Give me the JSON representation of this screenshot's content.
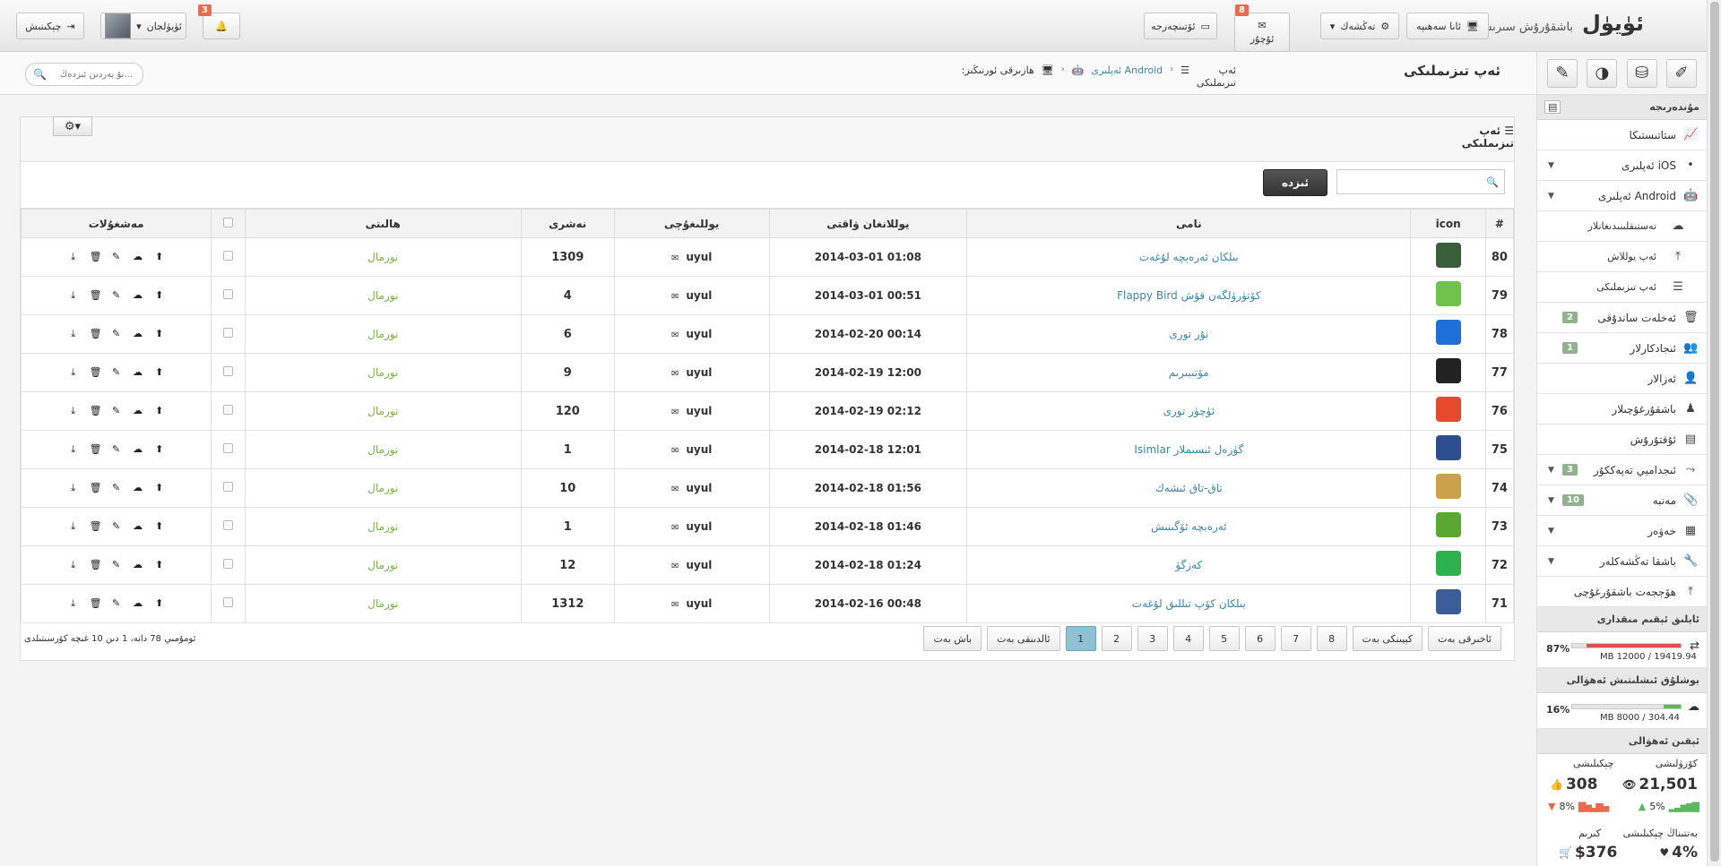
{
  "topbar": {
    "brand": "ئۈيۈل",
    "brand_sub": "باشقۇرۇش سىرىسى",
    "home_btn": "ئانا سەھىپە",
    "settings_btn": "تەڭشەك",
    "messages_btn": "ئۇچۇر",
    "messages_badge": "8",
    "credit_btn": "ئۆتىنچەرجە",
    "notify_badge": "3",
    "user_btn": "ئۈيۈلجان",
    "logout_btn": "چېكىنىش"
  },
  "crumbs": {
    "page_title": "ئەپ تىزىملىكى",
    "here": "ھازىرقى ئورنىڭىز:",
    "android": "Android ئەپلىرى",
    "current": "ئەپ تىزىملىكى",
    "search_placeholder": "بۇ يەردىن ئىزدەڭ..."
  },
  "panel": {
    "title": "ئەپ تىزىملىكى",
    "go_btn": "ئىزدە"
  },
  "table": {
    "headers": {
      "num": "#",
      "icon": "icon",
      "name": "نامى",
      "date": "يوللانغان ۋاقتى",
      "author": "يوللىغۇچى",
      "version": "نەشرى",
      "status": "ھالىتى",
      "actions": "مەشغۇلات"
    },
    "rows": [
      {
        "id": "80",
        "name": "بىلكان ئەرەبچە لۇغەت",
        "date": "2014-03-01 01:08",
        "author": "uyul",
        "version": "1309",
        "status": "نورمال",
        "icon_color": "#3a5f3a"
      },
      {
        "id": "79",
        "name": "Flappy Bird كۆتۈرۈلگەن قۇش",
        "date": "2014-03-01 00:51",
        "author": "uyul",
        "version": "4",
        "status": "نورمال",
        "icon_color": "#6fc24a"
      },
      {
        "id": "78",
        "name": "نۇر تورى",
        "date": "2014-02-20 00:14",
        "author": "uyul",
        "version": "6",
        "status": "نورمال",
        "icon_color": "#1e6fd9"
      },
      {
        "id": "77",
        "name": "مۆتىبىرىم",
        "date": "2014-02-19 12:00",
        "author": "uyul",
        "version": "9",
        "status": "نورمال",
        "icon_color": "#222222"
      },
      {
        "id": "76",
        "name": "ئۈچۈر تورى",
        "date": "2014-02-19 02:12",
        "author": "uyul",
        "version": "120",
        "status": "نورمال",
        "icon_color": "#e64a2e"
      },
      {
        "id": "75",
        "name": "Isimlar گۈزەل ئىسىملار",
        "date": "2014-02-18 12:01",
        "author": "uyul",
        "version": "1",
        "status": "نورمال",
        "icon_color": "#2d4e8f"
      },
      {
        "id": "74",
        "name": "تاق-تاق ئىشەك",
        "date": "2014-02-18 01:56",
        "author": "uyul",
        "version": "10",
        "status": "نورمال",
        "icon_color": "#c9a24a"
      },
      {
        "id": "73",
        "name": "ئەرەبچە ئۆگىنىش",
        "date": "2014-02-18 01:46",
        "author": "uyul",
        "version": "1",
        "status": "نورمال",
        "icon_color": "#5aa832"
      },
      {
        "id": "72",
        "name": "كەزگۈ",
        "date": "2014-02-18 01:24",
        "author": "uyul",
        "version": "12",
        "status": "نورمال",
        "icon_color": "#2bb24c"
      },
      {
        "id": "71",
        "name": "بىلكان كۆپ تىللىق لۇغەت",
        "date": "2014-02-16 00:48",
        "author": "uyul",
        "version": "1312",
        "status": "نورمال",
        "icon_color": "#3b5d9a"
      }
    ]
  },
  "pager": {
    "last": "ئاخىرقى بەت",
    "next": "كېيىنكى بەت",
    "pages": [
      "8",
      "7",
      "6",
      "5",
      "4",
      "3",
      "2",
      "1"
    ],
    "active": "1",
    "prev": "ئالدىنقى بەت",
    "first": "باش بەت",
    "total_text": "ئومۇمىي 78 دانە، 1 دىن 10 غىچە كۆرسىتىلدى"
  },
  "sidebar": {
    "section_main": "مۇندەرىجە",
    "items": [
      {
        "label": "ستاتىستىكا",
        "icon": "chart-icon"
      },
      {
        "label": "iOS ئەپلىرى",
        "icon": "apple-icon",
        "caret": true
      },
      {
        "label": "Android ئەپلىرى",
        "icon": "android-icon",
        "caret": true
      }
    ],
    "sub_items": [
      {
        "label": "تەستىقلىنىدىغانلار",
        "icon": "cloud-icon"
      },
      {
        "label": "ئەپ يوللاش",
        "icon": "upload-icon"
      },
      {
        "label": "ئەپ تىزىملىكى",
        "icon": "list-icon"
      }
    ],
    "items2": [
      {
        "label": "ئەخلەت ساندۇقى",
        "icon": "trash-icon",
        "count": "2"
      },
      {
        "label": "ئىجادكارلار",
        "icon": "users-icon",
        "count": "1"
      },
      {
        "label": "ئەزالار",
        "icon": "user-icon"
      },
      {
        "label": "باشقۇرغۇچىلار",
        "icon": "admin-icon"
      },
      {
        "label": "ئۇقتۇرۇش",
        "icon": "notice-icon"
      },
      {
        "label": "ئىجداميي تەپەككۇر",
        "icon": "share-icon",
        "count": "3",
        "caret": true
      },
      {
        "label": "مەنبە",
        "icon": "clip-icon",
        "count": "10",
        "caret": true
      },
      {
        "label": "خەۋەر",
        "icon": "news-icon",
        "caret": true
      },
      {
        "label": "باشقا تەڭشەكلەر",
        "icon": "wrench-icon",
        "caret": true
      },
      {
        "label": "ھۆججەت باشقۇرغۇچى",
        "icon": "file-upload-icon"
      }
    ],
    "storage_head": "ئايلىق ئېقىم مىقدارى",
    "storage_pct": "87%",
    "storage_pct_value": 87,
    "storage_text": "MB 12000 / 19419.94",
    "space_head": "بوشلۇق ئىشلىتىش ئەھۋالى",
    "space_pct": "16%",
    "space_pct_value": 16,
    "space_text": "MB 8000 / 304.44",
    "today_head": "ئېقىن ئەھۋالى",
    "views_label": "كۆرۈلىشى",
    "clicks_label": "چېكىلىشى",
    "views_value": "21,501",
    "clicks_value": "308",
    "views_change": "5%",
    "clicks_change": "8%",
    "rate_label": "بەتتىناڭ چېكىلىشى",
    "income_label": "كىرىم",
    "rate_value": "4%",
    "income_value": "$376"
  },
  "colors": {
    "accent": "#3a87ad",
    "status": "#7cb342",
    "danger": "#ed6b4c",
    "active_page": "#8fc1d4"
  }
}
